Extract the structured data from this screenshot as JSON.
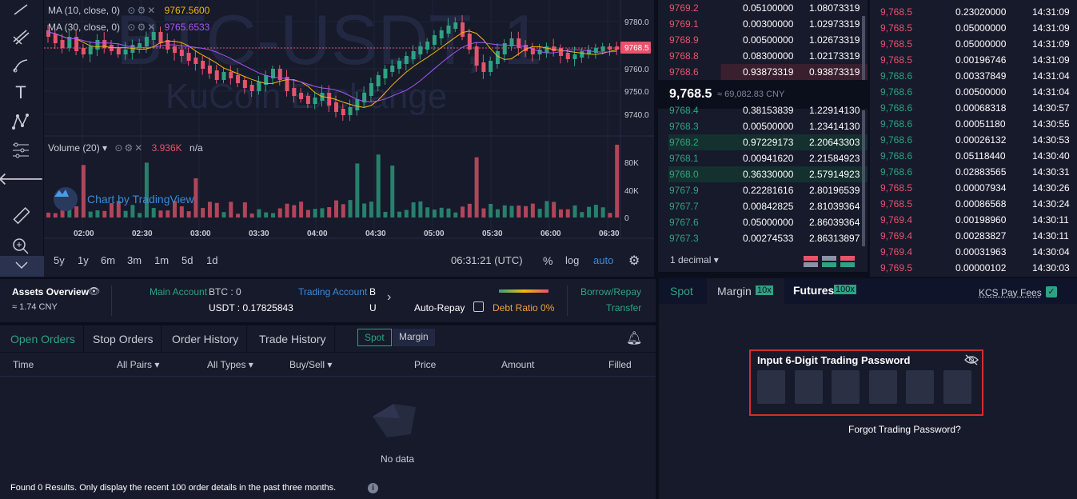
{
  "chart": {
    "watermark_pair": "BTC-USDT, 1",
    "watermark_exchange": "KuCoin Exchange",
    "ma10_label": "MA (10, close, 0)",
    "ma10_value": "9767.5600",
    "ma30_label": "MA (30, close, 0)",
    "ma30_value": "9765.6533",
    "volume_label": "Volume (20)",
    "volume_value": "3.936K",
    "volume_na": "n/a",
    "tradingview": "Chart by TradingView",
    "last_price_tag": "9768.5",
    "price_ticks": [
      "9780.0",
      "9770.0",
      "9760.0",
      "9750.0",
      "9740.0"
    ],
    "volume_ticks": [
      "80K",
      "40K",
      "0"
    ],
    "time_ticks": [
      "02:00",
      "02:30",
      "03:00",
      "03:30",
      "04:00",
      "04:30",
      "05:00",
      "05:30",
      "06:00",
      "06:30"
    ],
    "timeframes": [
      "5y",
      "1y",
      "6m",
      "3m",
      "1m",
      "5d",
      "1d"
    ],
    "clock": "06:31:21 (UTC)",
    "pct": "%",
    "log": "log",
    "auto": "auto",
    "colors": {
      "up": "#2ea383",
      "down": "#e6546b",
      "ma10": "#f0b90b",
      "ma30": "#a855f7"
    }
  },
  "orderbook": {
    "asks": [
      {
        "price": "9769.2",
        "amount": "0.05100000",
        "total": "1.08073319"
      },
      {
        "price": "9769.1",
        "amount": "0.00300000",
        "total": "1.02973319"
      },
      {
        "price": "9768.9",
        "amount": "0.00500000",
        "total": "1.02673319"
      },
      {
        "price": "9768.8",
        "amount": "0.08300000",
        "total": "1.02173319"
      },
      {
        "price": "9768.6",
        "amount": "0.93873319",
        "total": "0.93873319"
      }
    ],
    "mid_price": "9,768.5",
    "mid_cny": "≈ 69,082.83 CNY",
    "bids": [
      {
        "price": "9768.4",
        "amount": "0.38153839",
        "total": "1.22914130"
      },
      {
        "price": "9768.3",
        "amount": "0.00500000",
        "total": "1.23414130"
      },
      {
        "price": "9768.2",
        "amount": "0.97229173",
        "total": "2.20643303"
      },
      {
        "price": "9768.1",
        "amount": "0.00941620",
        "total": "2.21584923"
      },
      {
        "price": "9768.0",
        "amount": "0.36330000",
        "total": "2.57914923"
      },
      {
        "price": "9767.9",
        "amount": "0.22281616",
        "total": "2.80196539"
      },
      {
        "price": "9767.7",
        "amount": "0.00842825",
        "total": "2.81039364"
      },
      {
        "price": "9767.6",
        "amount": "0.05000000",
        "total": "2.86039364"
      },
      {
        "price": "9767.3",
        "amount": "0.00274533",
        "total": "2.86313897"
      }
    ],
    "decimal": "1 decimal"
  },
  "trades": [
    {
      "price": "9,768.5",
      "side": "down",
      "amount": "0.23020000",
      "time": "14:31:09"
    },
    {
      "price": "9,768.5",
      "side": "down",
      "amount": "0.05000000",
      "time": "14:31:09"
    },
    {
      "price": "9,768.5",
      "side": "down",
      "amount": "0.05000000",
      "time": "14:31:09"
    },
    {
      "price": "9,768.5",
      "side": "down",
      "amount": "0.00196746",
      "time": "14:31:09"
    },
    {
      "price": "9,768.6",
      "side": "up",
      "amount": "0.00337849",
      "time": "14:31:04"
    },
    {
      "price": "9,768.6",
      "side": "up",
      "amount": "0.00500000",
      "time": "14:31:04"
    },
    {
      "price": "9,768.6",
      "side": "up",
      "amount": "0.00068318",
      "time": "14:30:57"
    },
    {
      "price": "9,768.6",
      "side": "up",
      "amount": "0.00051180",
      "time": "14:30:55"
    },
    {
      "price": "9,768.6",
      "side": "up",
      "amount": "0.00026132",
      "time": "14:30:53"
    },
    {
      "price": "9,768.6",
      "side": "up",
      "amount": "0.05118440",
      "time": "14:30:40"
    },
    {
      "price": "9,768.6",
      "side": "up",
      "amount": "0.02883565",
      "time": "14:30:31"
    },
    {
      "price": "9,768.5",
      "side": "down",
      "amount": "0.00007934",
      "time": "14:30:26"
    },
    {
      "price": "9,768.5",
      "side": "down",
      "amount": "0.00086568",
      "time": "14:30:24"
    },
    {
      "price": "9,769.4",
      "side": "down",
      "amount": "0.00198960",
      "time": "14:30:11"
    },
    {
      "price": "9,769.4",
      "side": "down",
      "amount": "0.00283827",
      "time": "14:30:11"
    },
    {
      "price": "9,769.4",
      "side": "down",
      "amount": "0.00031963",
      "time": "14:30:04"
    },
    {
      "price": "9,769.5",
      "side": "down",
      "amount": "0.00000102",
      "time": "14:30:03"
    }
  ],
  "assets": {
    "title": "Assets Overview",
    "cny": "≈ 1.74 CNY",
    "main_label": "Main Account",
    "main_btc": "BTC : 0",
    "main_usdt": "USDT : 0.17825843",
    "trading_label": "Trading Account",
    "trading_b": "B",
    "trading_u": "U",
    "auto_repay": "Auto-Repay",
    "debt_ratio": "Debt Ratio 0%",
    "borrow_repay": "Borrow/Repay",
    "transfer": "Transfer"
  },
  "orders": {
    "tabs": [
      "Open Orders",
      "Stop Orders",
      "Order History",
      "Trade History"
    ],
    "spot": "Spot",
    "margin": "Margin",
    "columns": {
      "time": "Time",
      "pairs": "All Pairs",
      "types": "All Types",
      "buysell": "Buy/Sell",
      "price": "Price",
      "amount": "Amount",
      "filled": "Filled"
    },
    "empty": "No data",
    "footer": "Found 0 Results. Only display the recent 100 order details in the past three months."
  },
  "tradepanel": {
    "tab_spot": "Spot",
    "tab_margin": "Margin",
    "margin_badge": "10x",
    "tab_futures": "Futures",
    "futures_badge": "100x",
    "kcs_fees": "KCS Pay Fees",
    "password_title": "Input 6-Digit Trading Password",
    "forgot": "Forgot Trading Password?"
  }
}
